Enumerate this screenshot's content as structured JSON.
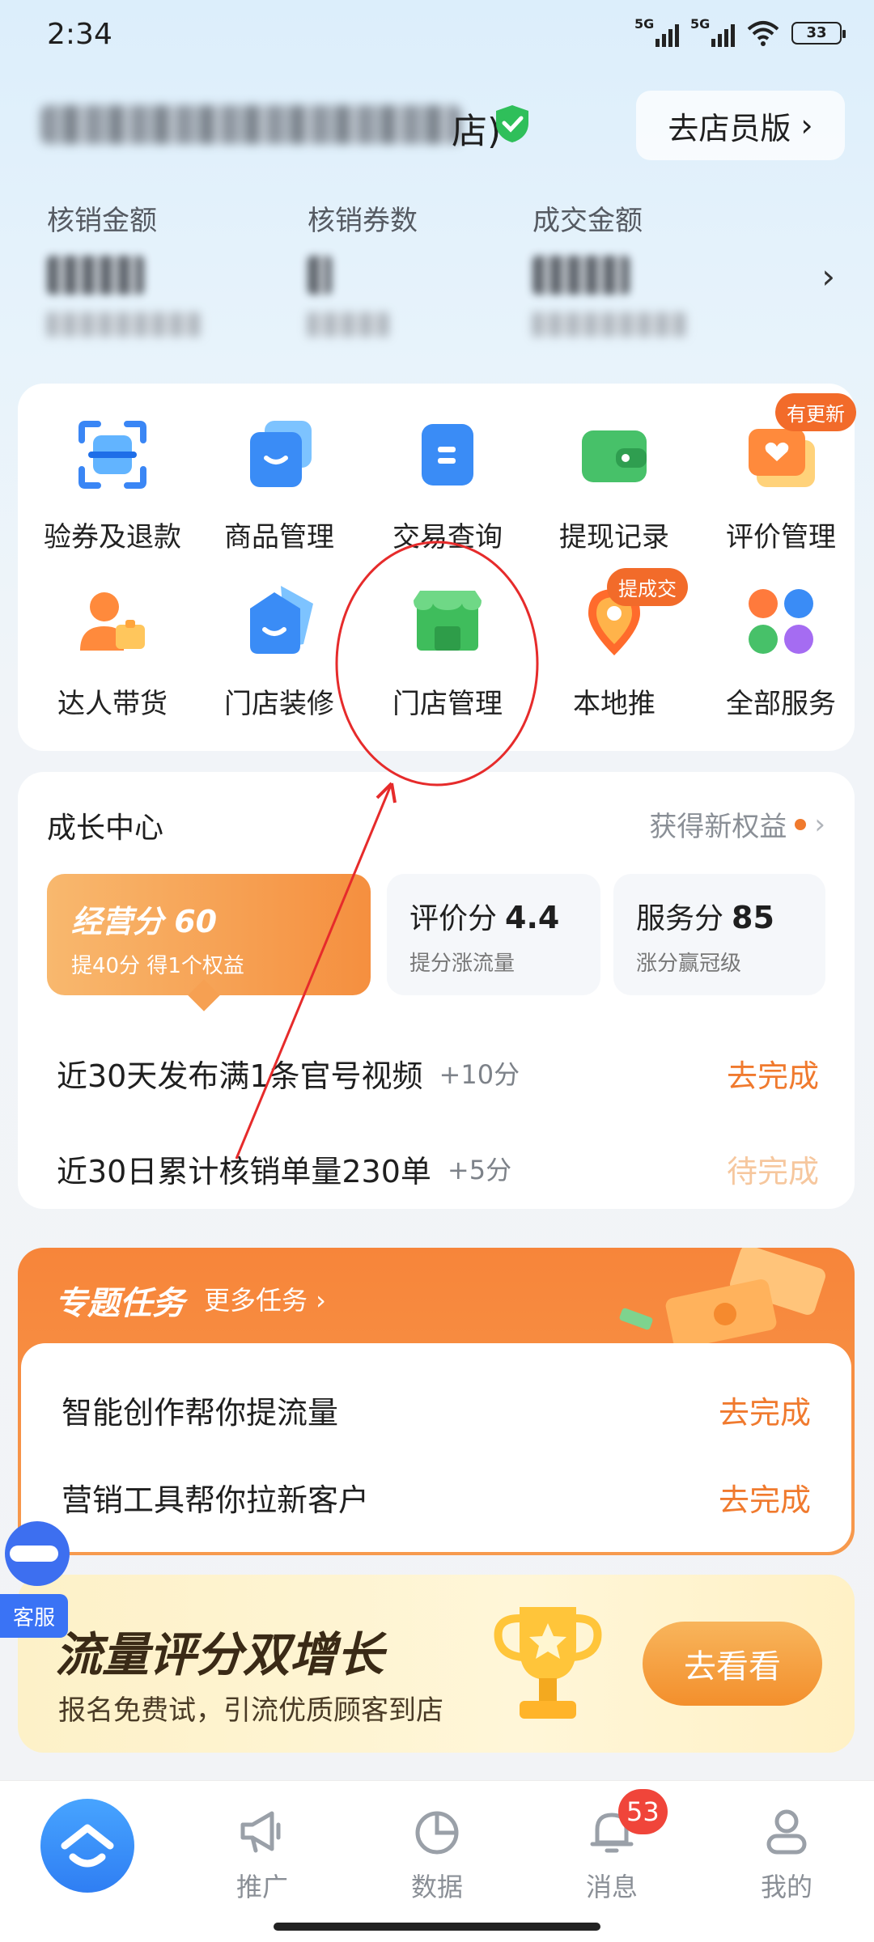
{
  "status_bar": {
    "time": "2:34",
    "signal1": "5G",
    "signal2": "5G",
    "battery": "33"
  },
  "header": {
    "shop_name_suffix": "店)",
    "staff_button": "去店员版",
    "stats": [
      {
        "label": "核销金额"
      },
      {
        "label": "核销券数"
      },
      {
        "label": "成交金额"
      }
    ]
  },
  "services": {
    "items": [
      {
        "label": "验券及退款",
        "icon": "scan-icon"
      },
      {
        "label": "商品管理",
        "icon": "product-icon"
      },
      {
        "label": "交易查询",
        "icon": "trade-query-icon"
      },
      {
        "label": "提现记录",
        "icon": "wallet-icon"
      },
      {
        "label": "评价管理",
        "icon": "review-icon",
        "tag": "有更新"
      },
      {
        "label": "达人带货",
        "icon": "influencer-icon"
      },
      {
        "label": "门店装修",
        "icon": "store-decor-icon"
      },
      {
        "label": "门店管理",
        "icon": "store-manage-icon"
      },
      {
        "label": "本地推",
        "icon": "local-promo-icon",
        "tag": "提成交"
      },
      {
        "label": "全部服务",
        "icon": "all-services-icon"
      }
    ]
  },
  "growth": {
    "title": "成长中心",
    "right_link": "获得新权益",
    "main_score": {
      "title": "经营分 60",
      "sub": "提40分 得1个权益"
    },
    "review_score": {
      "label": "评价分",
      "value": "4.4",
      "sub": "提分涨流量"
    },
    "service_score": {
      "label": "服务分",
      "value": "85",
      "sub": "涨分赢冠级"
    },
    "tasks": [
      {
        "text": "近30天发布满1条官号视频",
        "points": "+10分",
        "action": "去完成"
      },
      {
        "text": "近30日累计核销单量230单",
        "points": "+5分",
        "action": "待完成"
      }
    ]
  },
  "special_tasks": {
    "title": "专题任务",
    "more": "更多任务 ›",
    "items": [
      {
        "text": "智能创作帮你提流量",
        "action": "去完成"
      },
      {
        "text": "营销工具帮你拉新客户",
        "action": "去完成"
      }
    ]
  },
  "promo": {
    "title": "流量评分双增长",
    "subtitle": "报名免费试，引流优质顾客到店",
    "button": "去看看"
  },
  "customer_service": {
    "label": "客服"
  },
  "bottom_nav": {
    "items": [
      {
        "label": "推广"
      },
      {
        "label": "数据"
      },
      {
        "label": "消息",
        "badge": "53"
      },
      {
        "label": "我的"
      }
    ]
  },
  "colors": {
    "accent": "#f07a2e",
    "brand_blue": "#2f7ef3",
    "annotation_red": "#e62b2b"
  }
}
